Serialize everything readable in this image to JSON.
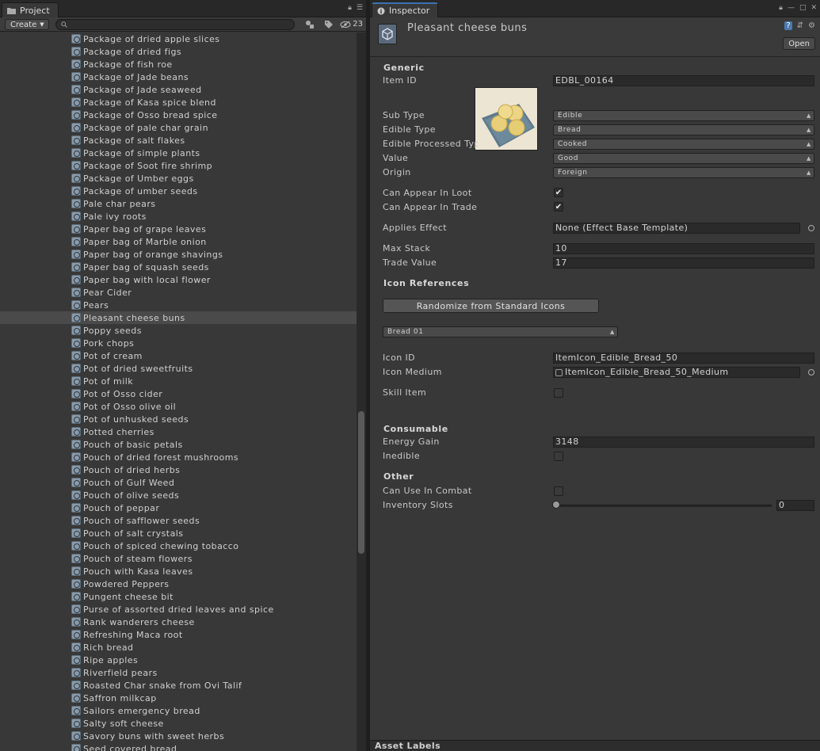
{
  "project": {
    "tab_label": "Project",
    "create_label": "Create",
    "search_placeholder": "",
    "hidden_count": "23",
    "selected_index": 22,
    "items": [
      "Package of dried apple slices",
      "Package of dried figs",
      "Package of fish roe",
      "Package of Jade beans",
      "Package of Jade seaweed",
      "Package of Kasa spice blend",
      "Package of Osso bread spice",
      "Package of pale char grain",
      "Package of salt flakes",
      "Package of simple plants",
      "Package of Soot fire shrimp",
      "Package of Umber eggs",
      "Package of umber seeds",
      "Pale char pears",
      "Pale ivy roots",
      "Paper bag of grape leaves",
      "Paper bag of Marble onion",
      "Paper bag of orange shavings",
      "Paper bag of squash seeds",
      "Paper bag with local flower",
      "Pear Cider",
      "Pears",
      "Pleasant cheese buns",
      "Poppy seeds",
      "Pork chops",
      "Pot of cream",
      "Pot of dried sweetfruits",
      "Pot of milk",
      "Pot of Osso cider",
      "Pot of Osso olive oil",
      "Pot of unhusked seeds",
      "Potted cherries",
      "Pouch of basic petals",
      "Pouch of dried forest mushrooms",
      "Pouch of dried herbs",
      "Pouch of Gulf Weed",
      "Pouch of olive seeds",
      "Pouch of peppar",
      "Pouch of safflower seeds",
      "Pouch of salt crystals",
      "Pouch of spiced chewing tobacco",
      "Pouch of steam flowers",
      "Pouch with Kasa leaves",
      "Powdered Peppers",
      "Pungent cheese bit",
      "Purse of assorted dried leaves and spice",
      "Rank wanderers cheese",
      "Refreshing Maca root",
      "Rich bread",
      "Ripe apples",
      "Riverfield pears",
      "Roasted Char snake from Ovi Talif",
      "Saffron milkcap",
      "Sailors emergency bread",
      "Salty soft cheese",
      "Savory buns with sweet herbs",
      "Seed covered bread"
    ]
  },
  "inspector": {
    "tab_label": "Inspector",
    "object_title": "Pleasant cheese buns",
    "open_label": "Open",
    "generic": {
      "heading": "Generic",
      "item_id_label": "Item ID",
      "item_id": "EDBL_00164",
      "sub_type_label": "Sub Type",
      "sub_type": "Edible",
      "edible_type_label": "Edible Type",
      "edible_type": "Bread",
      "processed_label": "Edible Processed Typ",
      "processed": "Cooked",
      "value_label": "Value",
      "value": "Good",
      "origin_label": "Origin",
      "origin": "Foreign",
      "loot_label": "Can Appear In Loot",
      "loot": true,
      "trade_label": "Can Appear In Trade",
      "trade": true,
      "effect_label": "Applies Effect",
      "effect": "None (Effect Base Template)",
      "max_stack_label": "Max Stack",
      "max_stack": "10",
      "trade_value_label": "Trade Value",
      "trade_value": "17"
    },
    "icon_refs": {
      "heading": "Icon References",
      "randomize_label": "Randomize from Standard Icons",
      "icon_set": "Bread 01",
      "icon_id_label": "Icon ID",
      "icon_id": "ItemIcon_Edible_Bread_50",
      "icon_medium_label": "Icon Medium",
      "icon_medium": "ItemIcon_Edible_Bread_50_Medium",
      "skill_item_label": "Skill Item",
      "skill_item": false
    },
    "consumable": {
      "heading": "Consumable",
      "energy_label": "Energy Gain",
      "energy": "3148",
      "inedible_label": "Inedible",
      "inedible": false
    },
    "other": {
      "heading": "Other",
      "combat_label": "Can Use In Combat",
      "combat": false,
      "slots_label": "Inventory Slots",
      "slots": "0",
      "slots_fraction": 0
    },
    "asset_labels": "Asset Labels"
  },
  "colors": {
    "panel": "#383838",
    "selection": "#4a4a4a",
    "accent": "#3a72b0"
  }
}
